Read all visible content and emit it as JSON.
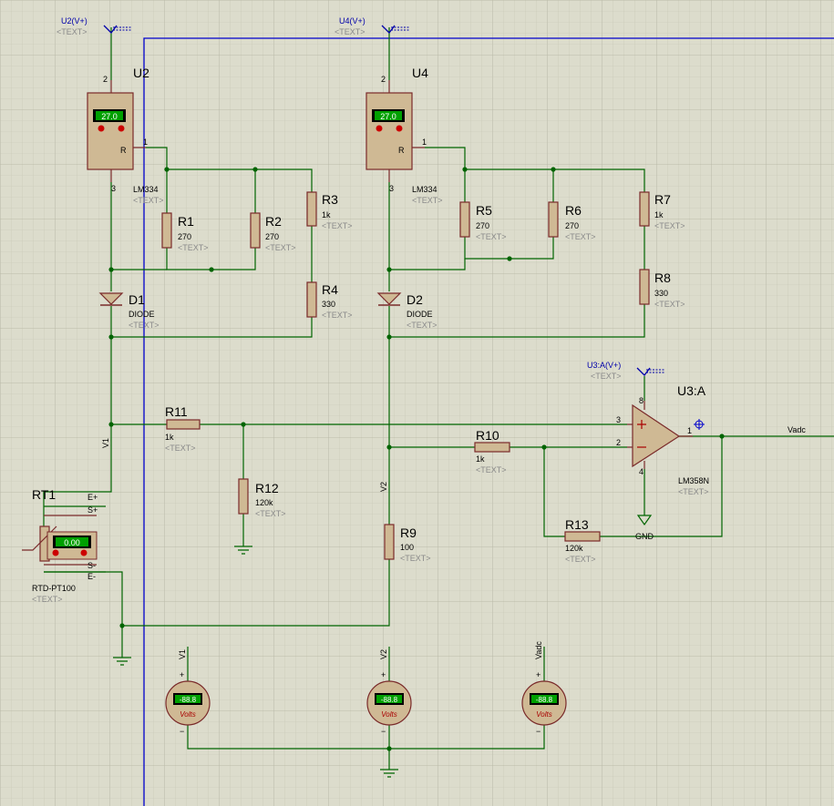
{
  "supplies": {
    "u2": {
      "label": "U2(V+)",
      "text": "<TEXT>"
    },
    "u4": {
      "label": "U4(V+)",
      "text": "<TEXT>"
    },
    "u3a": {
      "label": "U3:A(V+)",
      "text": "<TEXT>"
    }
  },
  "lm334": [
    {
      "name": "U2",
      "display": "27.0",
      "part": "LM334",
      "text": "<TEXT>",
      "pin_top": "2",
      "pin_r": "1",
      "pin_bottom": "3",
      "r_label": "R"
    },
    {
      "name": "U4",
      "display": "27.0",
      "part": "LM334",
      "text": "<TEXT>",
      "pin_top": "2",
      "pin_r": "1",
      "pin_bottom": "3",
      "r_label": "R"
    }
  ],
  "resistors": {
    "R1": {
      "name": "R1",
      "value": "270",
      "text": "<TEXT>"
    },
    "R2": {
      "name": "R2",
      "value": "270",
      "text": "<TEXT>"
    },
    "R3": {
      "name": "R3",
      "value": "1k",
      "text": "<TEXT>"
    },
    "R4": {
      "name": "R4",
      "value": "330",
      "text": "<TEXT>"
    },
    "R5": {
      "name": "R5",
      "value": "270",
      "text": "<TEXT>"
    },
    "R6": {
      "name": "R6",
      "value": "270",
      "text": "<TEXT>"
    },
    "R7": {
      "name": "R7",
      "value": "1k",
      "text": "<TEXT>"
    },
    "R8": {
      "name": "R8",
      "value": "330",
      "text": "<TEXT>"
    },
    "R9": {
      "name": "R9",
      "value": "100",
      "text": "<TEXT>"
    },
    "R10": {
      "name": "R10",
      "value": "1k",
      "text": "<TEXT>"
    },
    "R11": {
      "name": "R11",
      "value": "1k",
      "text": "<TEXT>"
    },
    "R12": {
      "name": "R12",
      "value": "120k",
      "text": "<TEXT>"
    },
    "R13": {
      "name": "R13",
      "value": "120k",
      "text": "<TEXT>"
    }
  },
  "diodes": {
    "D1": {
      "name": "D1",
      "part": "DIODE",
      "text": "<TEXT>"
    },
    "D2": {
      "name": "D2",
      "part": "DIODE",
      "text": "<TEXT>"
    }
  },
  "opamp": {
    "name": "U3:A",
    "part": "LM358N",
    "text": "<TEXT>",
    "pin_plus": "3",
    "pin_minus": "2",
    "pin_out": "1",
    "pin_vcc": "8",
    "pin_gnd": "4"
  },
  "rtd": {
    "name": "RT1",
    "part": "RTD-PT100",
    "text": "<TEXT>",
    "display": "0.00",
    "pins": [
      "E+",
      "S+",
      "S-",
      "E-"
    ]
  },
  "net_labels": {
    "v1": "V1",
    "v2": "V2",
    "vadc": "Vadc",
    "gnd": "GND"
  },
  "voltmeters": [
    {
      "probe": "V1",
      "display": "-88.8",
      "unit": "Volts"
    },
    {
      "probe": "V2",
      "display": "-88.8",
      "unit": "Volts"
    },
    {
      "probe": "Vadc",
      "display": "-88.8",
      "unit": "Volts"
    }
  ],
  "colors": {
    "background": "#dcdccc",
    "wire": "#006400",
    "body": "#cfb994",
    "outline": "#7a2a2a",
    "frame": "#0000cc",
    "lcd": "#00a000"
  }
}
